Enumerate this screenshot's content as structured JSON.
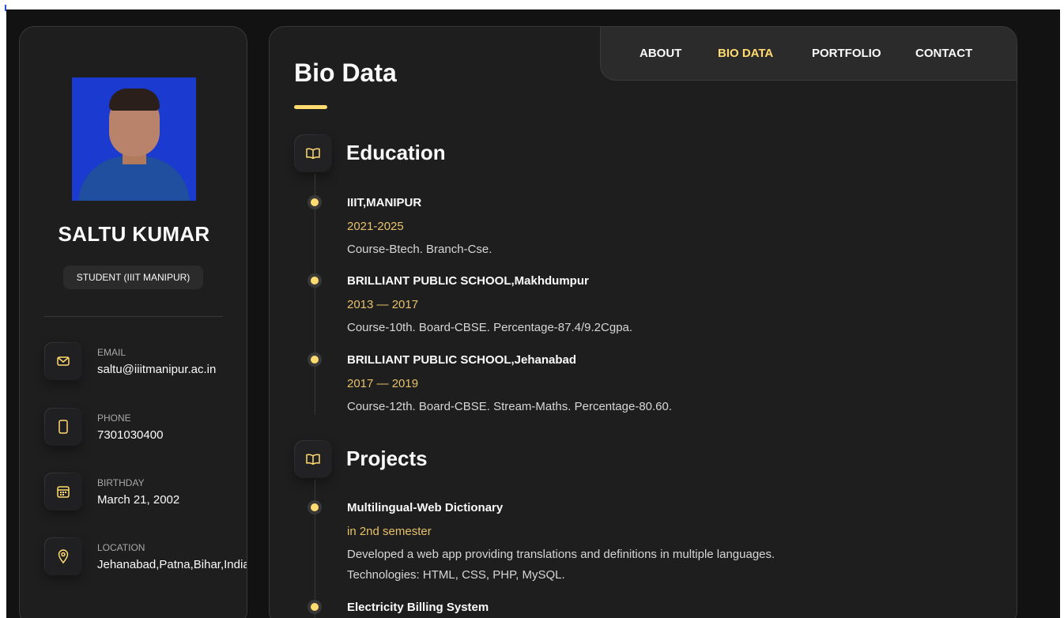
{
  "sidebar": {
    "name": "SALTU KUMAR",
    "title": "STUDENT (IIIT MANIPUR)",
    "contacts": [
      {
        "label": "EMAIL",
        "value": "saltu@iiitmanipur.ac.in",
        "icon": "mail-icon"
      },
      {
        "label": "PHONE",
        "value": "7301030400",
        "icon": "phone-icon"
      },
      {
        "label": "BIRTHDAY",
        "value": "March 21, 2002",
        "icon": "calendar-icon"
      },
      {
        "label": "LOCATION",
        "value": "Jehanabad,Patna,Bihar,India",
        "icon": "location-icon"
      }
    ],
    "socials": [
      "facebook-icon",
      "twitter-icon",
      "instagram-icon"
    ]
  },
  "navbar": {
    "links": [
      "ABOUT",
      "BIO DATA",
      "PORTFOLIO",
      "CONTACT"
    ],
    "active": "BIO DATA"
  },
  "article": {
    "title": "Bio Data",
    "sections": [
      {
        "title": "Education",
        "icon": "book-open-icon",
        "items": [
          {
            "title": "IIIT,MANIPUR",
            "date": "2021-2025",
            "text": [
              "Course-Btech. Branch-Cse."
            ]
          },
          {
            "title": "BRILLIANT PUBLIC SCHOOL,Makhdumpur",
            "date": "2013 — 2017",
            "text": [
              "Course-10th. Board-CBSE. Percentage-87.4/9.2Cgpa."
            ]
          },
          {
            "title": "BRILLIANT PUBLIC SCHOOL,Jehanabad",
            "date": "2017 — 2019",
            "text": [
              "Course-12th. Board-CBSE. Stream-Maths. Percentage-80.60."
            ]
          }
        ]
      },
      {
        "title": "Projects",
        "icon": "book-open-icon",
        "items": [
          {
            "title": "Multilingual-Web Dictionary",
            "date": "in 2nd semester",
            "text": [
              "Developed a web app providing translations and definitions in multiple languages.",
              "Technologies: HTML, CSS, PHP, MySQL."
            ]
          },
          {
            "title": "Electricity Billing System",
            "date": "",
            "text": []
          }
        ]
      }
    ]
  },
  "colors": {
    "accent": "#ffdb70",
    "background": "#121212",
    "card": "#1e1e1f",
    "text": "#d6d6d6"
  }
}
